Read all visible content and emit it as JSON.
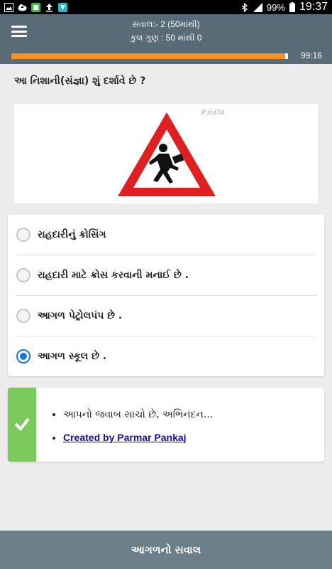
{
  "status_bar": {
    "battery": "99%",
    "time": "19:37",
    "icons": [
      "image-icon",
      "cloud-upload-icon",
      "app-icon",
      "upload-icon",
      "app-icon-2",
      "bluetooth-icon",
      "signal-icon",
      "battery-icon"
    ]
  },
  "header": {
    "question_counter": "સવાલ:- 2 (50માંથી)",
    "total_score": "કુલ ગુણ : 50 માંથી 0"
  },
  "progress": {
    "value_fraction": 0.99,
    "timer": "99:16",
    "fill_color": "#f7931e"
  },
  "question": {
    "text": "આ નિશાની(સંજ્ઞા) શું દર્શાવે છે ?",
    "watermark": "P.sid34",
    "sign": "school-ahead-triangle"
  },
  "options": [
    {
      "label": "રાહદારીનું ક્રોસિંગ",
      "selected": false
    },
    {
      "label": "રાહદારી માટે ક્રોસ કરવાની મનાઈ છે .",
      "selected": false
    },
    {
      "label": "આગળ પેટ્રોલપંપ છે .",
      "selected": false
    },
    {
      "label": "આગળ સ્કૂલ છે .",
      "selected": true
    }
  ],
  "feedback": {
    "message": "આપનો જવાબ સાચો છે, અભિનંદન...",
    "credit": "Created by Parmar Pankaj",
    "accent_color": "#7cc95c"
  },
  "footer": {
    "next_button": "આગળનો સવાલ"
  },
  "colors": {
    "header_bg": "#586b76",
    "footer_bg": "#6d7f8a",
    "radio_selected": "#1976d2"
  }
}
